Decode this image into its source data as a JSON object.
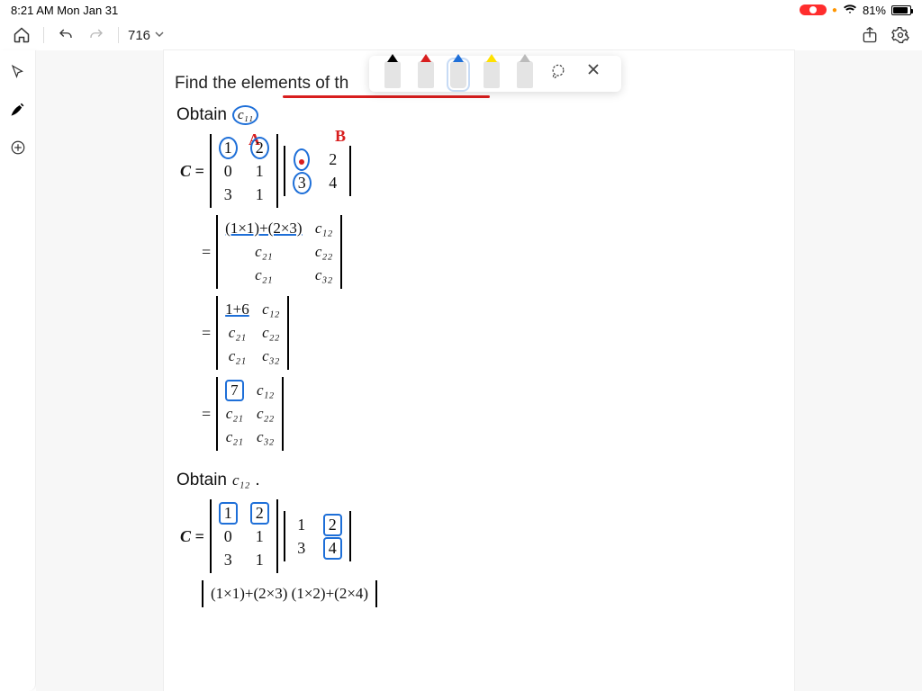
{
  "status": {
    "time_date": "8:21 AM   Mon Jan 31",
    "battery_pct": "81%"
  },
  "toolbar": {
    "doc_title": "716"
  },
  "tooltray": {
    "pens": [
      "black",
      "red",
      "blue",
      "yellow",
      "grey"
    ],
    "active_pen_index": 2
  },
  "content": {
    "heading": "Find the elements of th",
    "obtain1_label": "Obtain",
    "obtain1_target": "c₁₁",
    "annot_A": "A",
    "annot_B": "B",
    "C_label": "C =",
    "eq_sign": "=",
    "matrixA": [
      [
        "1",
        "2"
      ],
      [
        "0",
        "1"
      ],
      [
        "3",
        "1"
      ]
    ],
    "matrixB": [
      [
        "1",
        "2"
      ],
      [
        "3",
        "4"
      ]
    ],
    "step1_tl": "(1×1)+(2×3)",
    "c12": "c₁₂",
    "c21": "c₂₁",
    "c22": "c₂₂",
    "c32": "c₃₂",
    "step2_tl": "1+6",
    "step3_tl": "7",
    "obtain2_label": "Obtain",
    "obtain2_target": "c₁₂",
    "period": ".",
    "step4_row": "(1×1)+(2×3)   (1×2)+(2×4)"
  }
}
